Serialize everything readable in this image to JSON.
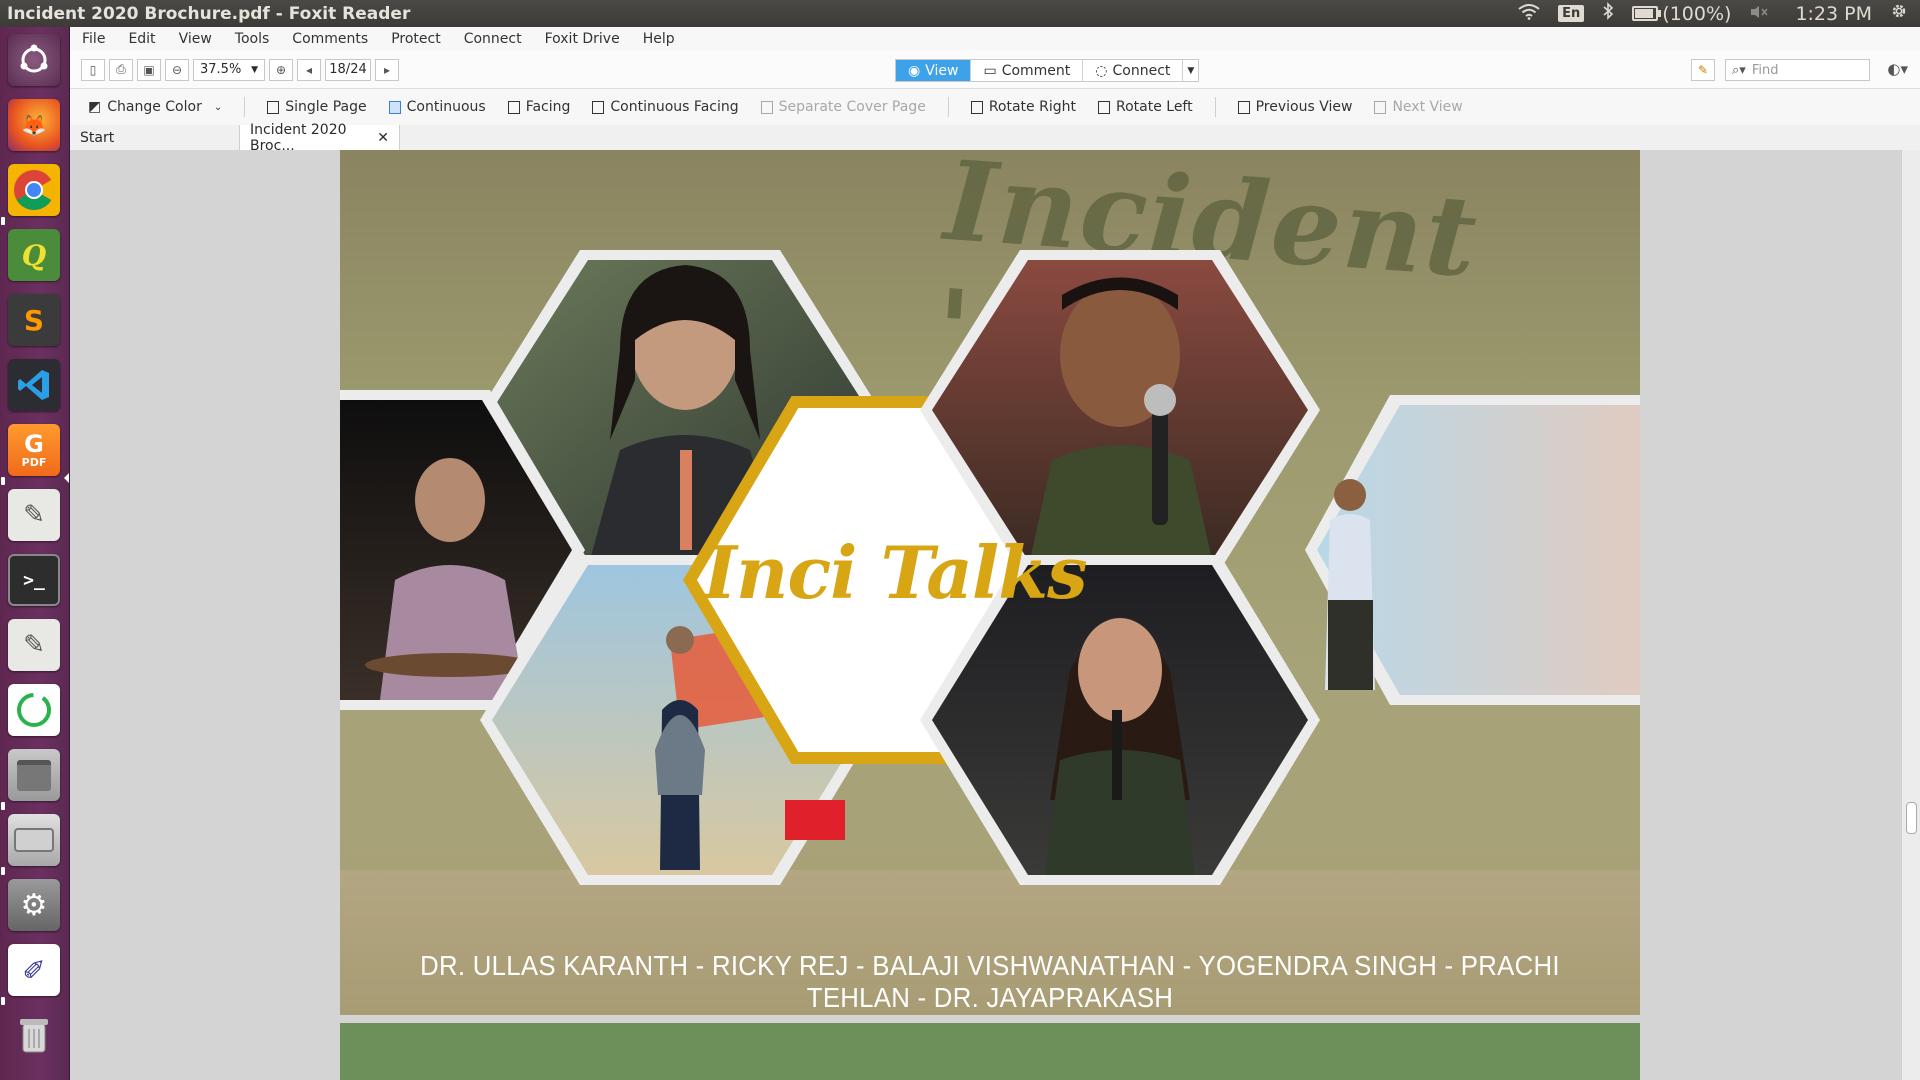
{
  "window": {
    "title": "Incident 2020 Brochure.pdf - Foxit Reader"
  },
  "system_tray": {
    "keyboard": "En",
    "battery": "(100%)",
    "battery_level": 1.0,
    "clock": "1:23 PM"
  },
  "launcher": {
    "items": [
      "ubuntu-dash-icon",
      "firefox-icon",
      "chrome-icon",
      "qgis-icon",
      "sublime-text-icon",
      "vscode-icon",
      "foxit-pdf-icon",
      "text-editor-icon",
      "terminal-icon",
      "text-editor-2-icon",
      "sync-app-icon",
      "file-archive-icon",
      "disk-drive-icon",
      "system-settings-icon",
      "paint-app-icon",
      "trash-icon"
    ]
  },
  "menubar": {
    "items": [
      "File",
      "Edit",
      "View",
      "Tools",
      "Comments",
      "Protect",
      "Connect",
      "Foxit Drive",
      "Help"
    ]
  },
  "toolbar": {
    "zoom": "37.5%",
    "page_indicator": "18/24",
    "modes": [
      "View",
      "Comment",
      "Connect"
    ],
    "find_placeholder": "Find"
  },
  "view_toolbar": {
    "change_color": "Change Color",
    "single_page": "Single Page",
    "continuous": "Continuous",
    "facing": "Facing",
    "continuous_facing": "Continuous Facing",
    "separate_cover": "Separate Cover Page",
    "rotate_right": "Rotate Right",
    "rotate_left": "Rotate Left",
    "previous_view": "Previous View",
    "next_view": "Next View"
  },
  "tabs": {
    "start": "Start",
    "document": "Incident 2020 Broc..."
  },
  "page": {
    "banner_text": "Incident '17",
    "center_title": "Inci Talks",
    "speakers_line": "DR. ULLAS KARANTH - RICKY REJ - BALAJI VISHWANATHAN - YOGENDRA SINGH - PRACHI TEHLAN - DR. JAYAPRAKASH",
    "accent_color": "#d8a514"
  }
}
